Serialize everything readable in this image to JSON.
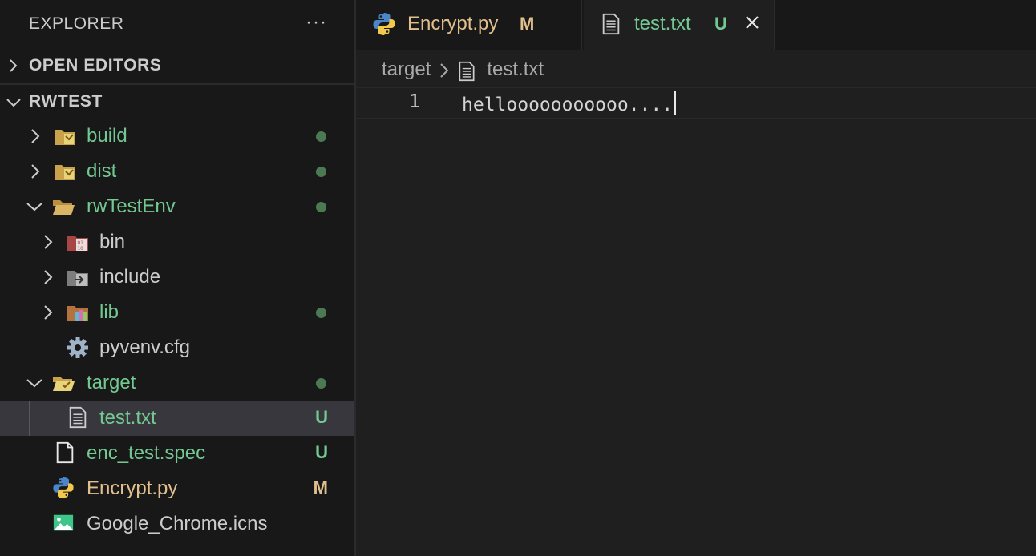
{
  "explorer": {
    "title": "EXPLORER",
    "more_label": "···",
    "open_editors": "OPEN EDITORS",
    "workspace": "RWTEST",
    "tree": [
      {
        "id": "build",
        "label": "build",
        "type": "folder",
        "color": "green",
        "status": "dot"
      },
      {
        "id": "dist",
        "label": "dist",
        "type": "folder",
        "color": "green",
        "status": "dot"
      },
      {
        "id": "rwTestEnv",
        "label": "rwTestEnv",
        "type": "folder-open",
        "color": "green",
        "status": "dot"
      },
      {
        "id": "bin",
        "label": "bin",
        "type": "folder-bin",
        "color": "white",
        "status": ""
      },
      {
        "id": "include",
        "label": "include",
        "type": "folder-include",
        "color": "white",
        "status": ""
      },
      {
        "id": "lib",
        "label": "lib",
        "type": "folder-lib",
        "color": "green",
        "status": "dot"
      },
      {
        "id": "pyvenv",
        "label": "pyvenv.cfg",
        "type": "gear-file",
        "color": "white",
        "status": ""
      },
      {
        "id": "target",
        "label": "target",
        "type": "folder-open",
        "color": "green",
        "status": "dot"
      },
      {
        "id": "test-txt",
        "label": "test.txt",
        "type": "text-file",
        "color": "green",
        "status": "U"
      },
      {
        "id": "enc-spec",
        "label": "enc_test.spec",
        "type": "blank-file",
        "color": "green",
        "status": "U"
      },
      {
        "id": "encrypt-py",
        "label": "Encrypt.py",
        "type": "python-file",
        "color": "mod",
        "status": "M"
      },
      {
        "id": "chrome-icns",
        "label": "Google_Chrome.icns",
        "type": "image-file",
        "color": "white",
        "status": ""
      }
    ]
  },
  "tabs": [
    {
      "label": "Encrypt.py",
      "badge": "M",
      "active": false
    },
    {
      "label": "test.txt",
      "badge": "U",
      "active": true,
      "close": "×"
    }
  ],
  "breadcrumb": {
    "folder": "target",
    "file": "test.txt"
  },
  "editor": {
    "lines": [
      {
        "number": "1",
        "text": "hellooooooooooo...."
      }
    ]
  },
  "colors": {
    "git_untracked": "#73c991",
    "git_modified": "#e2c08d",
    "sidebar_bg": "#181818",
    "editor_bg": "#1f1f1f",
    "selection_bg": "#37373d"
  }
}
